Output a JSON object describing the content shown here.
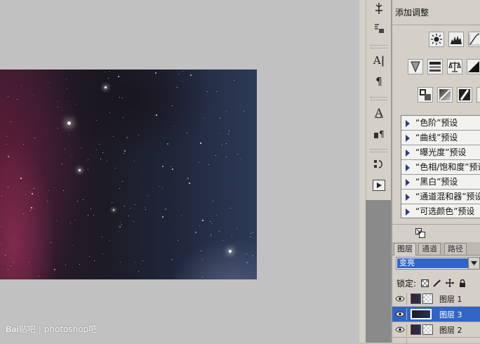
{
  "canvas": {
    "watermark": {
      "brand": "Bai",
      "brand_suffix": "贴吧",
      "separator": "|",
      "site": "photoshop吧"
    }
  },
  "toolstrip": {
    "tools": [
      {
        "name": "histogram-icon",
        "glyph": "⚗"
      },
      {
        "name": "info-icon",
        "glyph": "ℹ"
      },
      {
        "name": "character-icon",
        "glyph": "A|"
      },
      {
        "name": "paragraph-icon",
        "glyph": "¶"
      },
      {
        "name": "character-style-icon",
        "glyph": "A"
      },
      {
        "name": "paragraph-style-icon",
        "glyph": "¶"
      },
      {
        "name": "history-icon",
        "glyph": "⤸"
      },
      {
        "name": "actions-icon",
        "glyph": "▶"
      }
    ]
  },
  "adjustments": {
    "title": "添加调整",
    "presets": [
      "“色阶”预设",
      "“曲线”预设",
      "“曝光度”预设",
      "“色相/饱和度”预设",
      "“黑白”预设",
      "“通道混和器”预设",
      "“可选颜色”预设"
    ]
  },
  "layers": {
    "tabs": [
      "图层",
      "通道",
      "路径"
    ],
    "active_tab": "图层",
    "blend_mode": "变亮",
    "lock_label": "锁定:",
    "rows": [
      {
        "name": "图层 1",
        "visible": true,
        "selected": false
      },
      {
        "name": "图层 3",
        "visible": true,
        "selected": true
      },
      {
        "name": "图层 2",
        "visible": true,
        "selected": false
      }
    ]
  },
  "colors": {
    "selection": "#3165c5",
    "panel_bg": "#d4d0c8",
    "workspace_bg": "#c1c1c1"
  }
}
